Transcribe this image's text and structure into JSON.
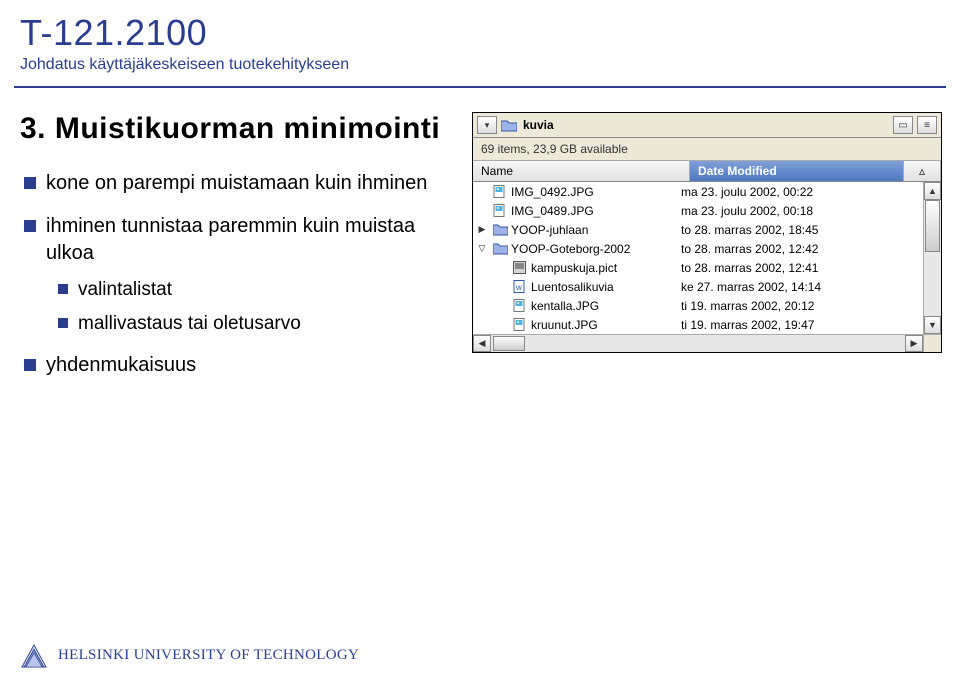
{
  "header": {
    "course_code": "T-121.2100",
    "course_sub": "Johdatus käyttäjäkeskeiseen tuotekehitykseen"
  },
  "slide": {
    "title": "3. Muistikuorman minimointi",
    "bullets": [
      {
        "text": "kone on parempi muistamaan kuin ihminen"
      },
      {
        "text": "ihminen tunnistaa paremmin kuin muistaa ulkoa",
        "sub": [
          "valintalistat",
          "mallivastaus tai oletusarvo"
        ]
      },
      {
        "text": "yhdenmukaisuus"
      }
    ]
  },
  "browser": {
    "title": "kuvia",
    "info": "69 items, 23,9 GB available",
    "columns": {
      "name": "Name",
      "date": "Date Modified"
    },
    "rows": [
      {
        "tri": "",
        "type": "img",
        "name": "IMG_0492.JPG",
        "date": "ma 23. joulu 2002, 00:22"
      },
      {
        "tri": "",
        "type": "img",
        "name": "IMG_0489.JPG",
        "date": "ma 23. joulu 2002, 00:18"
      },
      {
        "tri": "▶",
        "type": "folder",
        "name": "YOOP-juhlaan",
        "date": "to 28. marras 2002, 18:45"
      },
      {
        "tri": "▽",
        "type": "folder",
        "name": "YOOP-Goteborg-2002",
        "date": "to 28. marras 2002, 12:42"
      },
      {
        "tri": "",
        "type": "pict",
        "name": "kampuskuja.pict",
        "date": "to 28. marras 2002, 12:41"
      },
      {
        "tri": "",
        "type": "doc",
        "name": "Luentosalikuvia",
        "date": "ke 27. marras 2002, 14:14"
      },
      {
        "tri": "",
        "type": "img",
        "name": "kentalla.JPG",
        "date": "ti 19. marras 2002, 20:12"
      },
      {
        "tri": "",
        "type": "img",
        "name": "kruunut.JPG",
        "date": "ti 19. marras 2002, 19:47"
      }
    ]
  },
  "footer": {
    "text": "HELSINKI UNIVERSITY OF TECHNOLOGY"
  }
}
